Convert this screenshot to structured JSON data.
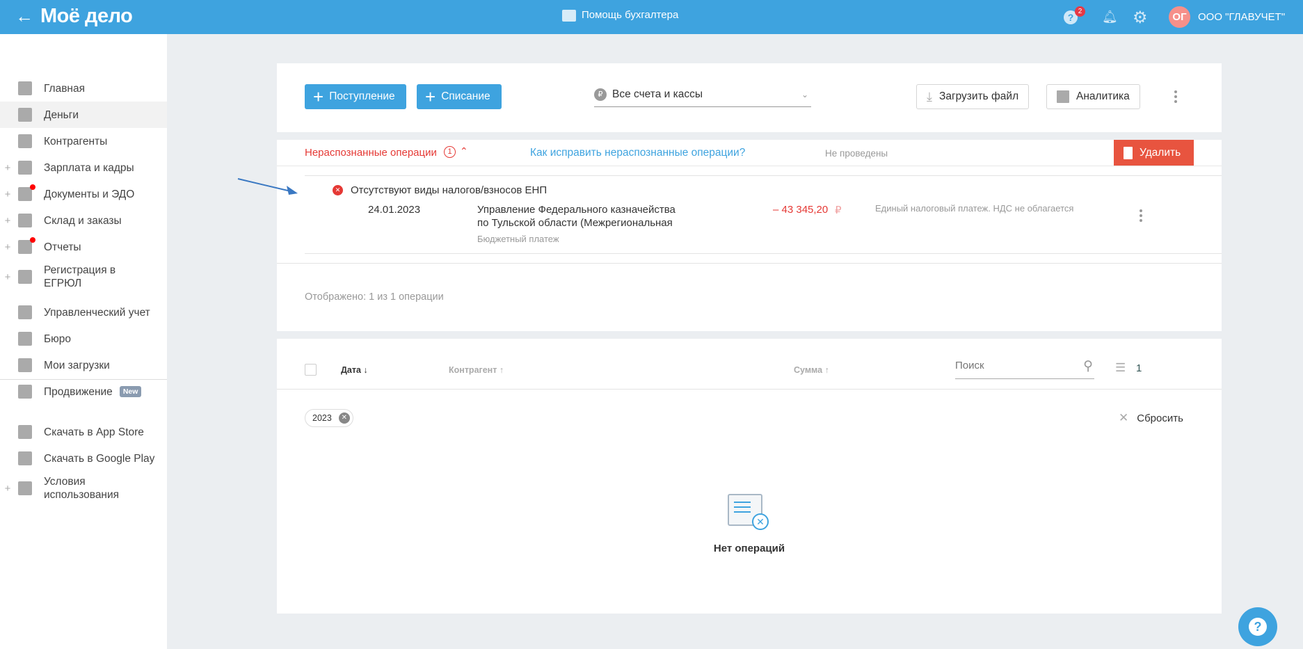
{
  "header": {
    "back": "←",
    "logo": "Моё дело",
    "helper": "Помощь бухгалтера",
    "help_badge": "2",
    "avatar": "ОГ",
    "company": "ООО \"ГЛАВУЧЕТ\""
  },
  "sidebar": {
    "items": [
      {
        "label": "Главная",
        "icon": "home-icon",
        "plus": false
      },
      {
        "label": "Деньги",
        "icon": "money-icon",
        "plus": false,
        "active": true
      },
      {
        "label": "Контрагенты",
        "icon": "contractor-icon",
        "plus": false
      },
      {
        "label": "Зарплата и кадры",
        "icon": "wallet-icon",
        "plus": true
      },
      {
        "label": "Документы и ЭДО",
        "icon": "folder-icon",
        "plus": true,
        "dot": true
      },
      {
        "label": "Склад и заказы",
        "icon": "cart-icon",
        "plus": true
      },
      {
        "label": "Отчеты",
        "icon": "report-icon",
        "plus": true,
        "dot": true
      },
      {
        "label": "Регистрация в ЕГРЮЛ",
        "icon": "registration-icon",
        "plus": true
      },
      {
        "label": "Управленческий учет",
        "icon": "management-icon",
        "plus": false
      },
      {
        "label": "Бюро",
        "icon": "briefcase-icon",
        "plus": false
      },
      {
        "label": "Мои загрузки",
        "icon": "folder-icon",
        "plus": false
      },
      {
        "label": "Продвижение",
        "icon": "chart-icon",
        "plus": false,
        "badge": "New"
      },
      {
        "label": "Скачать в App Store",
        "icon": "apple-icon",
        "plus": false
      },
      {
        "label": "Скачать в Google Play",
        "icon": "google-play-icon",
        "plus": false
      },
      {
        "label": "Условия использования",
        "icon": "more-icon",
        "plus": true
      }
    ]
  },
  "toolbar": {
    "income": "Поступление",
    "expense": "Списание",
    "account_select": "Все счета и кассы",
    "upload": "Загрузить файл",
    "analytics": "Аналитика"
  },
  "unrecognized": {
    "title": "Нераспознанные операции",
    "count": "1",
    "help_link": "Как исправить нераспознанные операции?",
    "status": "Не проведены",
    "delete": "Удалить",
    "error": "Отсутствуют виды налогов/взносов ЕНП",
    "row": {
      "date": "24.01.2023",
      "contractor_line1": "Управление Федерального казначейства",
      "contractor_line2": "по Тульской области (Межрегиональная",
      "type": "Бюджетный платеж",
      "amount": "– 43 345,20",
      "currency": "₽",
      "description": "Единый налоговый платеж. НДС не облагается"
    },
    "shown": "Отображено: 1 из 1 операции"
  },
  "table": {
    "col_date": "Дата ↓",
    "col_contractor": "Контрагент ↑",
    "col_sum": "Сумма ↑",
    "search_placeholder": "Поиск",
    "filter_count": "1",
    "chip": "2023",
    "reset": "Сбросить",
    "empty": "Нет операций"
  },
  "colors": {
    "brand": "#3ea3df",
    "danger": "#e8543f",
    "error_text": "#e53935"
  }
}
